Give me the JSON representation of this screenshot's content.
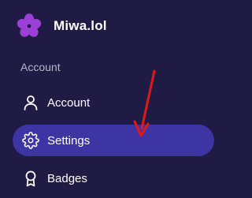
{
  "brand": {
    "name": "Miwa.lol",
    "logo_icon": "flower-logo-icon",
    "logo_color": "#9b3fd6"
  },
  "sidebar": {
    "section_title": "Account",
    "items": [
      {
        "label": "Account",
        "icon": "user-icon",
        "active": false
      },
      {
        "label": "Settings",
        "icon": "gear-icon",
        "active": true
      },
      {
        "label": "Badges",
        "icon": "badge-icon",
        "active": false
      }
    ]
  },
  "colors": {
    "background": "#1f1b45",
    "active_item": "#3d35a3",
    "section_title": "#b8b4cf",
    "annotation_arrow": "#e01818"
  },
  "annotation": {
    "type": "arrow",
    "points_to": "Settings"
  }
}
